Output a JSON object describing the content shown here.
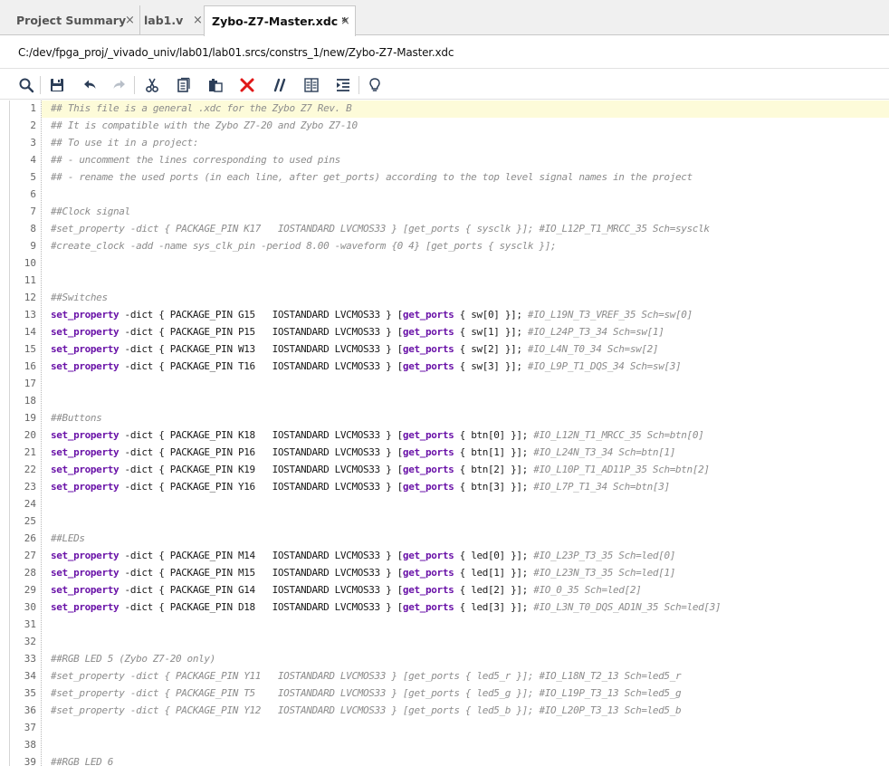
{
  "tabs": [
    {
      "label": "Project Summary"
    },
    {
      "label": "lab1.v"
    },
    {
      "label": "Zybo-Z7-Master.xdc *"
    }
  ],
  "file_path": "C:/dev/fpga_proj/_vivado_univ/lab01/lab01.srcs/constrs_1/new/Zybo-Z7-Master.xdc",
  "close_glyph": "×",
  "toolbar": [
    "search-icon",
    "save-icon",
    "undo-icon",
    "redo-icon",
    "cut-icon",
    "copy-icon",
    "paste-icon",
    "delete-icon",
    "comment-icon",
    "toggle-columns-icon",
    "indent-icon",
    "lightbulb-icon"
  ],
  "colors": {
    "keyword": "#6a13a8",
    "comment": "#8c8c8c",
    "delete": "#e01818",
    "current_line": "#fdfbd9"
  },
  "editor": {
    "lines": [
      {
        "n": "1",
        "parts": [
          {
            "t": "## This file is a general .xdc for the Zybo Z7 Rev. B",
            "c": "comment"
          }
        ]
      },
      {
        "n": "2",
        "parts": [
          {
            "t": "## It is compatible with the Zybo Z7-20 and Zybo Z7-10",
            "c": "comment"
          }
        ]
      },
      {
        "n": "3",
        "parts": [
          {
            "t": "## To use it in a project:",
            "c": "comment"
          }
        ]
      },
      {
        "n": "4",
        "parts": [
          {
            "t": "## - uncomment the lines corresponding to used pins",
            "c": "comment"
          }
        ]
      },
      {
        "n": "5",
        "parts": [
          {
            "t": "## - rename the used ports (in each line, after get_ports) according to the top level signal names in the project",
            "c": "comment"
          }
        ]
      },
      {
        "n": "6",
        "parts": []
      },
      {
        "n": "7",
        "parts": [
          {
            "t": "##Clock signal",
            "c": "comment"
          }
        ]
      },
      {
        "n": "8",
        "parts": [
          {
            "t": "#set_property -dict { PACKAGE_PIN K17   IOSTANDARD LVCMOS33 } [get_ports { sysclk }]; #IO_L12P_T1_MRCC_35 Sch=sysclk",
            "c": "comment"
          }
        ]
      },
      {
        "n": "9",
        "parts": [
          {
            "t": "#create_clock -add -name sys_clk_pin -period 8.00 -waveform {0 4} [get_ports { sysclk }];",
            "c": "comment"
          }
        ]
      },
      {
        "n": "10",
        "parts": []
      },
      {
        "n": "11",
        "parts": []
      },
      {
        "n": "12",
        "parts": [
          {
            "t": "##Switches",
            "c": "comment"
          }
        ]
      },
      {
        "n": "13",
        "parts": [
          {
            "t": "set_property",
            "c": "kw"
          },
          {
            "t": " -dict { PACKAGE_PIN G15   IOSTANDARD LVCMOS33 } [",
            "c": ""
          },
          {
            "t": "get_ports",
            "c": "kw"
          },
          {
            "t": " { sw[0] }]; ",
            "c": ""
          },
          {
            "t": "#IO_L19N_T3_VREF_35 Sch=sw[0]",
            "c": "comment"
          }
        ]
      },
      {
        "n": "14",
        "parts": [
          {
            "t": "set_property",
            "c": "kw"
          },
          {
            "t": " -dict { PACKAGE_PIN P15   IOSTANDARD LVCMOS33 } [",
            "c": ""
          },
          {
            "t": "get_ports",
            "c": "kw"
          },
          {
            "t": " { sw[1] }]; ",
            "c": ""
          },
          {
            "t": "#IO_L24P_T3_34 Sch=sw[1]",
            "c": "comment"
          }
        ]
      },
      {
        "n": "15",
        "parts": [
          {
            "t": "set_property",
            "c": "kw"
          },
          {
            "t": " -dict { PACKAGE_PIN W13   IOSTANDARD LVCMOS33 } [",
            "c": ""
          },
          {
            "t": "get_ports",
            "c": "kw"
          },
          {
            "t": " { sw[2] }]; ",
            "c": ""
          },
          {
            "t": "#IO_L4N_T0_34 Sch=sw[2]",
            "c": "comment"
          }
        ]
      },
      {
        "n": "16",
        "parts": [
          {
            "t": "set_property",
            "c": "kw"
          },
          {
            "t": " -dict { PACKAGE_PIN T16   IOSTANDARD LVCMOS33 } [",
            "c": ""
          },
          {
            "t": "get_ports",
            "c": "kw"
          },
          {
            "t": " { sw[3] }]; ",
            "c": ""
          },
          {
            "t": "#IO_L9P_T1_DQS_34 Sch=sw[3]",
            "c": "comment"
          }
        ]
      },
      {
        "n": "17",
        "parts": []
      },
      {
        "n": "18",
        "parts": []
      },
      {
        "n": "19",
        "parts": [
          {
            "t": "##Buttons",
            "c": "comment"
          }
        ]
      },
      {
        "n": "20",
        "parts": [
          {
            "t": "set_property",
            "c": "kw"
          },
          {
            "t": " -dict { PACKAGE_PIN K18   IOSTANDARD LVCMOS33 } [",
            "c": ""
          },
          {
            "t": "get_ports",
            "c": "kw"
          },
          {
            "t": " { btn[0] }]; ",
            "c": ""
          },
          {
            "t": "#IO_L12N_T1_MRCC_35 Sch=btn[0]",
            "c": "comment"
          }
        ]
      },
      {
        "n": "21",
        "parts": [
          {
            "t": "set_property",
            "c": "kw"
          },
          {
            "t": " -dict { PACKAGE_PIN P16   IOSTANDARD LVCMOS33 } [",
            "c": ""
          },
          {
            "t": "get_ports",
            "c": "kw"
          },
          {
            "t": " { btn[1] }]; ",
            "c": ""
          },
          {
            "t": "#IO_L24N_T3_34 Sch=btn[1]",
            "c": "comment"
          }
        ]
      },
      {
        "n": "22",
        "parts": [
          {
            "t": "set_property",
            "c": "kw"
          },
          {
            "t": " -dict { PACKAGE_PIN K19   IOSTANDARD LVCMOS33 } [",
            "c": ""
          },
          {
            "t": "get_ports",
            "c": "kw"
          },
          {
            "t": " { btn[2] }]; ",
            "c": ""
          },
          {
            "t": "#IO_L10P_T1_AD11P_35 Sch=btn[2]",
            "c": "comment"
          }
        ]
      },
      {
        "n": "23",
        "parts": [
          {
            "t": "set_property",
            "c": "kw"
          },
          {
            "t": " -dict { PACKAGE_PIN Y16   IOSTANDARD LVCMOS33 } [",
            "c": ""
          },
          {
            "t": "get_ports",
            "c": "kw"
          },
          {
            "t": " { btn[3] }]; ",
            "c": ""
          },
          {
            "t": "#IO_L7P_T1_34 Sch=btn[3]",
            "c": "comment"
          }
        ]
      },
      {
        "n": "24",
        "parts": []
      },
      {
        "n": "25",
        "parts": []
      },
      {
        "n": "26",
        "parts": [
          {
            "t": "##LEDs",
            "c": "comment"
          }
        ]
      },
      {
        "n": "27",
        "parts": [
          {
            "t": "set_property",
            "c": "kw"
          },
          {
            "t": " -dict { PACKAGE_PIN M14   IOSTANDARD LVCMOS33 } [",
            "c": ""
          },
          {
            "t": "get_ports",
            "c": "kw"
          },
          {
            "t": " { led[0] }]; ",
            "c": ""
          },
          {
            "t": "#IO_L23P_T3_35 Sch=led[0]",
            "c": "comment"
          }
        ]
      },
      {
        "n": "28",
        "parts": [
          {
            "t": "set_property",
            "c": "kw"
          },
          {
            "t": " -dict { PACKAGE_PIN M15   IOSTANDARD LVCMOS33 } [",
            "c": ""
          },
          {
            "t": "get_ports",
            "c": "kw"
          },
          {
            "t": " { led[1] }]; ",
            "c": ""
          },
          {
            "t": "#IO_L23N_T3_35 Sch=led[1]",
            "c": "comment"
          }
        ]
      },
      {
        "n": "29",
        "parts": [
          {
            "t": "set_property",
            "c": "kw"
          },
          {
            "t": " -dict { PACKAGE_PIN G14   IOSTANDARD LVCMOS33 } [",
            "c": ""
          },
          {
            "t": "get_ports",
            "c": "kw"
          },
          {
            "t": " { led[2] }]; ",
            "c": ""
          },
          {
            "t": "#IO_0_35 Sch=led[2]",
            "c": "comment"
          }
        ]
      },
      {
        "n": "30",
        "parts": [
          {
            "t": "set_property",
            "c": "kw"
          },
          {
            "t": " -dict { PACKAGE_PIN D18   IOSTANDARD LVCMOS33 } [",
            "c": ""
          },
          {
            "t": "get_ports",
            "c": "kw"
          },
          {
            "t": " { led[3] }]; ",
            "c": ""
          },
          {
            "t": "#IO_L3N_T0_DQS_AD1N_35 Sch=led[3]",
            "c": "comment"
          }
        ]
      },
      {
        "n": "31",
        "parts": []
      },
      {
        "n": "32",
        "parts": []
      },
      {
        "n": "33",
        "parts": [
          {
            "t": "##RGB LED 5 (Zybo Z7-20 only)",
            "c": "comment"
          }
        ]
      },
      {
        "n": "34",
        "parts": [
          {
            "t": "#set_property -dict { PACKAGE_PIN Y11   IOSTANDARD LVCMOS33 } [get_ports { led5_r }]; #IO_L18N_T2_13 Sch=led5_r",
            "c": "comment"
          }
        ]
      },
      {
        "n": "35",
        "parts": [
          {
            "t": "#set_property -dict { PACKAGE_PIN T5    IOSTANDARD LVCMOS33 } [get_ports { led5_g }]; #IO_L19P_T3_13 Sch=led5_g",
            "c": "comment"
          }
        ]
      },
      {
        "n": "36",
        "parts": [
          {
            "t": "#set_property -dict { PACKAGE_PIN Y12   IOSTANDARD LVCMOS33 } [get_ports { led5_b }]; #IO_L20P_T3_13 Sch=led5_b",
            "c": "comment"
          }
        ]
      },
      {
        "n": "37",
        "parts": []
      },
      {
        "n": "38",
        "parts": []
      },
      {
        "n": "39",
        "parts": [
          {
            "t": "##RGB LED 6",
            "c": "comment"
          }
        ]
      }
    ]
  }
}
